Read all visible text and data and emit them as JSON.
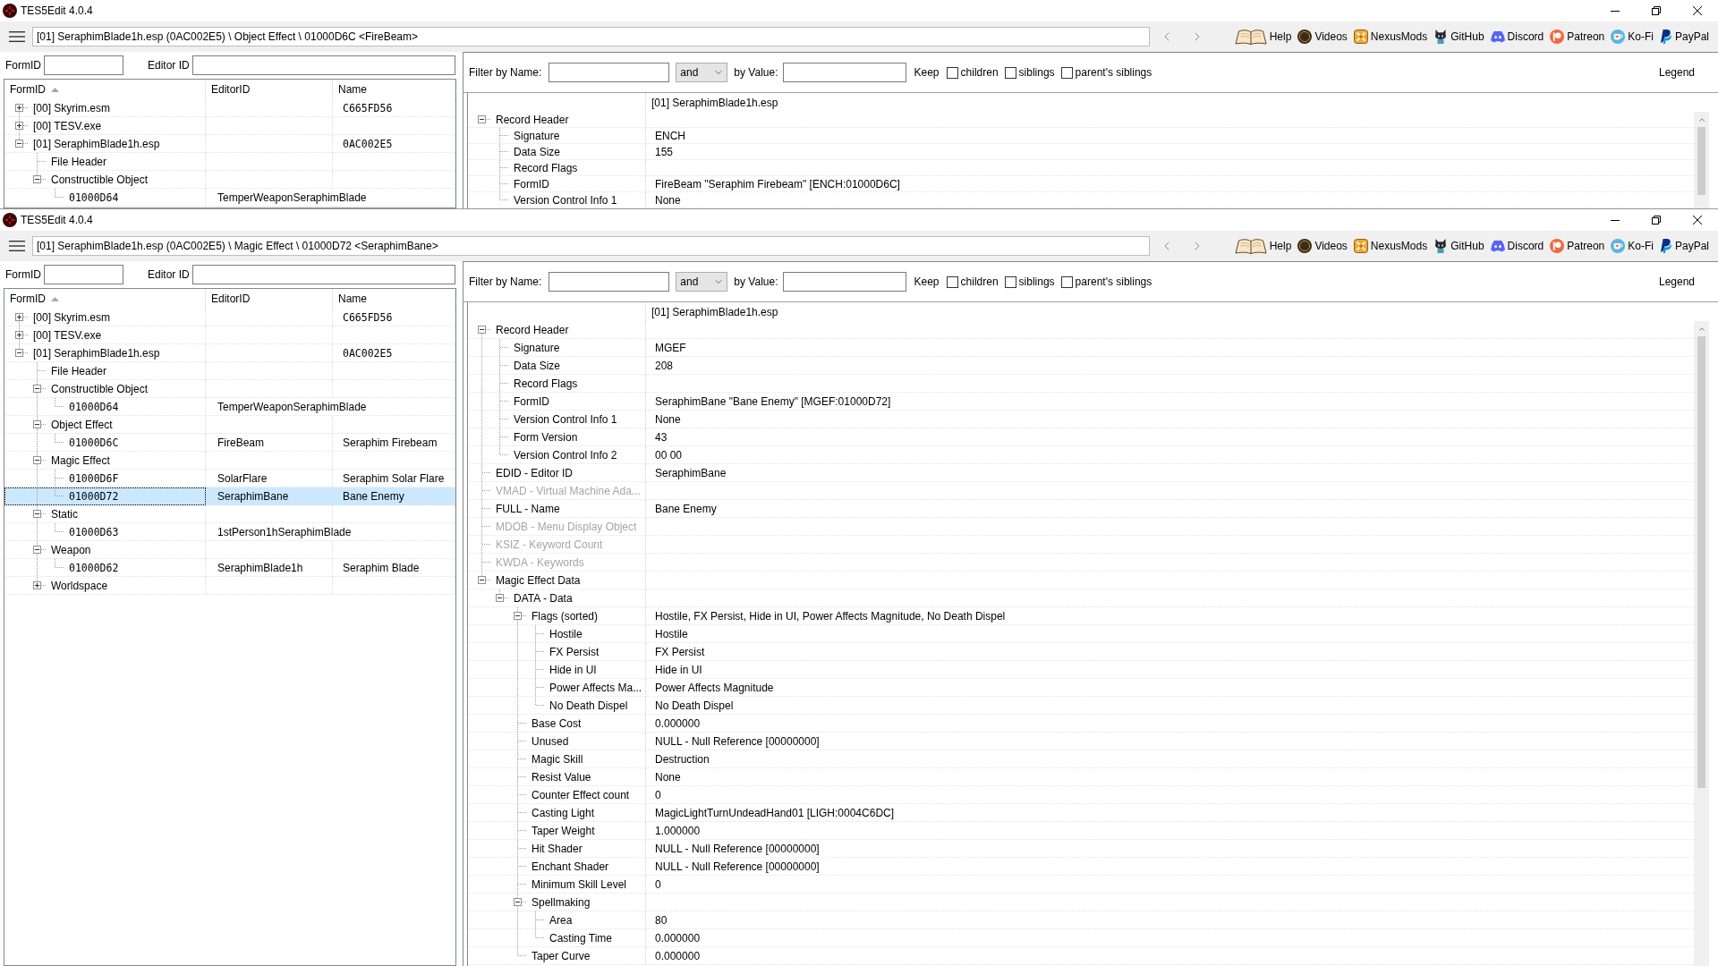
{
  "windows": [
    {
      "title": "TES5Edit 4.0.4",
      "toolbar": {
        "path": "[01] SeraphimBlade1h.esp (0AC002E5) \\ Object Effect \\ 01000D6C <FireBeam>",
        "links": [
          {
            "kind": "book",
            "label": "Help"
          },
          {
            "kind": "coin",
            "label": "Videos"
          },
          {
            "kind": "cross",
            "label": "NexusMods"
          },
          {
            "kind": "cat",
            "label": "GitHub"
          },
          {
            "kind": "gamepad",
            "label": "Discord"
          },
          {
            "kind": "circle_p",
            "label": "Patreon"
          },
          {
            "kind": "cup",
            "label": "Ko-Fi"
          },
          {
            "kind": "p_logo",
            "label": "PayPal"
          }
        ]
      },
      "search": {
        "formid_label": "FormID",
        "editorid_label": "Editor ID"
      },
      "tree": {
        "columns": [
          {
            "label": "FormID",
            "sorted": true
          },
          {
            "label": "EditorID",
            "sorted": false
          },
          {
            "label": "Name",
            "sorted": false
          }
        ],
        "rows": [
          {
            "kind": "file",
            "form_id": "[00] Skyrim.esm",
            "name": "C665FD56",
            "expanded": false,
            "selected": false
          },
          {
            "kind": "file",
            "form_id": "[00] TESV.exe",
            "expanded": false,
            "selected": false
          },
          {
            "kind": "file",
            "form_id": "[01] SeraphimBlade1h.esp",
            "name": "0AC002E5",
            "expanded": true,
            "selected": false,
            "children": [
              {
                "kind": "group",
                "form_id": "File Header",
                "selected": false
              },
              {
                "kind": "group",
                "form_id": "Constructible Object",
                "expanded": true,
                "selected": false,
                "children": [
                  {
                    "kind": "record",
                    "form_id": "01000D64",
                    "editor_id": "TemperWeaponSeraphimBlade",
                    "selected": false
                  }
                ]
              }
            ]
          }
        ]
      },
      "filter": {
        "name_label": "Filter by Name:",
        "operator": "and",
        "value_label": "by Value:",
        "keep_label": "Keep",
        "keep_options": [
          {
            "label": "children",
            "checked": false
          },
          {
            "label": "siblings",
            "checked": false
          },
          {
            "label": "parent's siblings",
            "checked": false
          }
        ],
        "legend": "Legend"
      },
      "record": {
        "header": "[01] SeraphimBlade1h.esp",
        "rows": [
          {
            "label": "Record Header",
            "expanded": true,
            "disabled": false,
            "children": [
              {
                "label": "Signature",
                "value": "ENCH"
              },
              {
                "label": "Data Size",
                "value": "155"
              },
              {
                "label": "Record Flags"
              },
              {
                "label": "FormID",
                "value": "FireBeam \"Seraphim Firebeam\" [ENCH:01000D6C]"
              },
              {
                "label": "Version Control Info 1",
                "value": "None"
              }
            ]
          }
        ]
      }
    },
    {
      "title": "TES5Edit 4.0.4",
      "toolbar": {
        "path": "[01] SeraphimBlade1h.esp (0AC002E5) \\ Magic Effect \\ 01000D72 <SeraphimBane>",
        "links": [
          {
            "kind": "book",
            "label": "Help"
          },
          {
            "kind": "coin",
            "label": "Videos"
          },
          {
            "kind": "cross",
            "label": "NexusMods"
          },
          {
            "kind": "cat",
            "label": "GitHub"
          },
          {
            "kind": "gamepad",
            "label": "Discord"
          },
          {
            "kind": "circle_p",
            "label": "Patreon"
          },
          {
            "kind": "cup",
            "label": "Ko-Fi"
          },
          {
            "kind": "p_logo",
            "label": "PayPal"
          }
        ]
      },
      "search": {
        "formid_label": "FormID",
        "editorid_label": "Editor ID"
      },
      "tree": {
        "columns": [
          {
            "label": "FormID",
            "sorted": true
          },
          {
            "label": "EditorID",
            "sorted": false
          },
          {
            "label": "Name",
            "sorted": false
          }
        ],
        "rows": [
          {
            "kind": "file",
            "form_id": "[00] Skyrim.esm",
            "name": "C665FD56",
            "expanded": false,
            "selected": false
          },
          {
            "kind": "file",
            "form_id": "[00] TESV.exe",
            "expanded": false,
            "selected": false
          },
          {
            "kind": "file",
            "form_id": "[01] SeraphimBlade1h.esp",
            "name": "0AC002E5",
            "expanded": true,
            "selected": false,
            "children": [
              {
                "kind": "group",
                "form_id": "File Header",
                "selected": false
              },
              {
                "kind": "group",
                "form_id": "Constructible Object",
                "expanded": true,
                "selected": false,
                "children": [
                  {
                    "kind": "record",
                    "form_id": "01000D64",
                    "editor_id": "TemperWeaponSeraphimBlade",
                    "selected": false
                  }
                ]
              },
              {
                "kind": "group",
                "form_id": "Object Effect",
                "expanded": true,
                "selected": false,
                "children": [
                  {
                    "kind": "record",
                    "form_id": "01000D6C",
                    "editor_id": "FireBeam",
                    "name": "Seraphim Firebeam",
                    "selected": false
                  }
                ]
              },
              {
                "kind": "group",
                "form_id": "Magic Effect",
                "expanded": true,
                "selected": false,
                "children": [
                  {
                    "kind": "record",
                    "form_id": "01000D6F",
                    "editor_id": "SolarFlare",
                    "name": "Seraphim Solar Flare",
                    "selected": false
                  },
                  {
                    "kind": "record",
                    "form_id": "01000D72",
                    "editor_id": "SeraphimBane",
                    "name": "Bane Enemy",
                    "selected": true
                  }
                ]
              },
              {
                "kind": "group",
                "form_id": "Static",
                "expanded": true,
                "selected": false,
                "children": [
                  {
                    "kind": "record",
                    "form_id": "01000D63",
                    "editor_id": "1stPerson1hSeraphimBlade",
                    "selected": false
                  }
                ]
              },
              {
                "kind": "group",
                "form_id": "Weapon",
                "expanded": true,
                "selected": false,
                "children": [
                  {
                    "kind": "record",
                    "form_id": "01000D62",
                    "editor_id": "SeraphimBlade1h",
                    "name": "Seraphim Blade",
                    "selected": false
                  }
                ]
              },
              {
                "kind": "group",
                "form_id": "Worldspace",
                "expanded": false,
                "selected": false
              }
            ]
          }
        ]
      },
      "filter": {
        "name_label": "Filter by Name:",
        "operator": "and",
        "value_label": "by Value:",
        "keep_label": "Keep",
        "keep_options": [
          {
            "label": "children",
            "checked": false
          },
          {
            "label": "siblings",
            "checked": false
          },
          {
            "label": "parent's siblings",
            "checked": false
          }
        ],
        "legend": "Legend"
      },
      "record": {
        "header": "[01] SeraphimBlade1h.esp",
        "rows": [
          {
            "label": "Record Header",
            "expanded": true,
            "disabled": false,
            "children": [
              {
                "label": "Signature",
                "value": "MGEF"
              },
              {
                "label": "Data Size",
                "value": "208"
              },
              {
                "label": "Record Flags"
              },
              {
                "label": "FormID",
                "value": "SeraphimBane \"Bane Enemy\" [MGEF:01000D72]"
              },
              {
                "label": "Version Control Info 1",
                "value": "None"
              },
              {
                "label": "Form Version",
                "value": "43"
              },
              {
                "label": "Version Control Info 2",
                "value": "00 00"
              }
            ]
          },
          {
            "label": "EDID - Editor ID",
            "value": "SeraphimBane",
            "disabled": false
          },
          {
            "label": "VMAD - Virtual Machine Ada...",
            "disabled": true
          },
          {
            "label": "FULL - Name",
            "value": "Bane Enemy",
            "disabled": false
          },
          {
            "label": "MDOB - Menu Display Object",
            "disabled": true
          },
          {
            "label": "KSIZ - Keyword Count",
            "disabled": true
          },
          {
            "label": "KWDA - Keywords",
            "disabled": true
          },
          {
            "label": "Magic Effect Data",
            "expanded": true,
            "disabled": false,
            "children": [
              {
                "label": "DATA - Data",
                "expanded": true,
                "children": [
                  {
                    "label": "Flags (sorted)",
                    "value": "Hostile, FX Persist, Hide in UI, Power Affects Magnitude, No Death Dispel",
                    "expanded": true,
                    "children": [
                      {
                        "label": "Hostile",
                        "value": "Hostile"
                      },
                      {
                        "label": "FX Persist",
                        "value": "FX Persist"
                      },
                      {
                        "label": "Hide in UI",
                        "value": "Hide in UI"
                      },
                      {
                        "label": "Power Affects Ma...",
                        "value": "Power Affects Magnitude"
                      },
                      {
                        "label": "No Death Dispel",
                        "value": "No Death Dispel"
                      }
                    ]
                  },
                  {
                    "label": "Base Cost",
                    "value": "0.000000"
                  },
                  {
                    "label": "Unused",
                    "value": "NULL - Null Reference [00000000]"
                  },
                  {
                    "label": "Magic Skill",
                    "value": "Destruction"
                  },
                  {
                    "label": "Resist Value",
                    "value": "None"
                  },
                  {
                    "label": "Counter Effect count",
                    "value": "0"
                  },
                  {
                    "label": "Casting Light",
                    "value": "MagicLightTurnUndeadHand01 [LIGH:0004C6DC]"
                  },
                  {
                    "label": "Taper Weight",
                    "value": "1.000000"
                  },
                  {
                    "label": "Hit Shader",
                    "value": "NULL - Null Reference [00000000]"
                  },
                  {
                    "label": "Enchant Shader",
                    "value": "NULL - Null Reference [00000000]"
                  },
                  {
                    "label": "Minimum Skill Level",
                    "value": "0"
                  },
                  {
                    "label": "Spellmaking",
                    "expanded": true,
                    "children": [
                      {
                        "label": "Area",
                        "value": "80"
                      },
                      {
                        "label": "Casting Time",
                        "value": "0.000000"
                      }
                    ]
                  },
                  {
                    "label": "Taper Curve",
                    "value": "0.000000"
                  }
                ]
              }
            ]
          }
        ]
      }
    }
  ]
}
